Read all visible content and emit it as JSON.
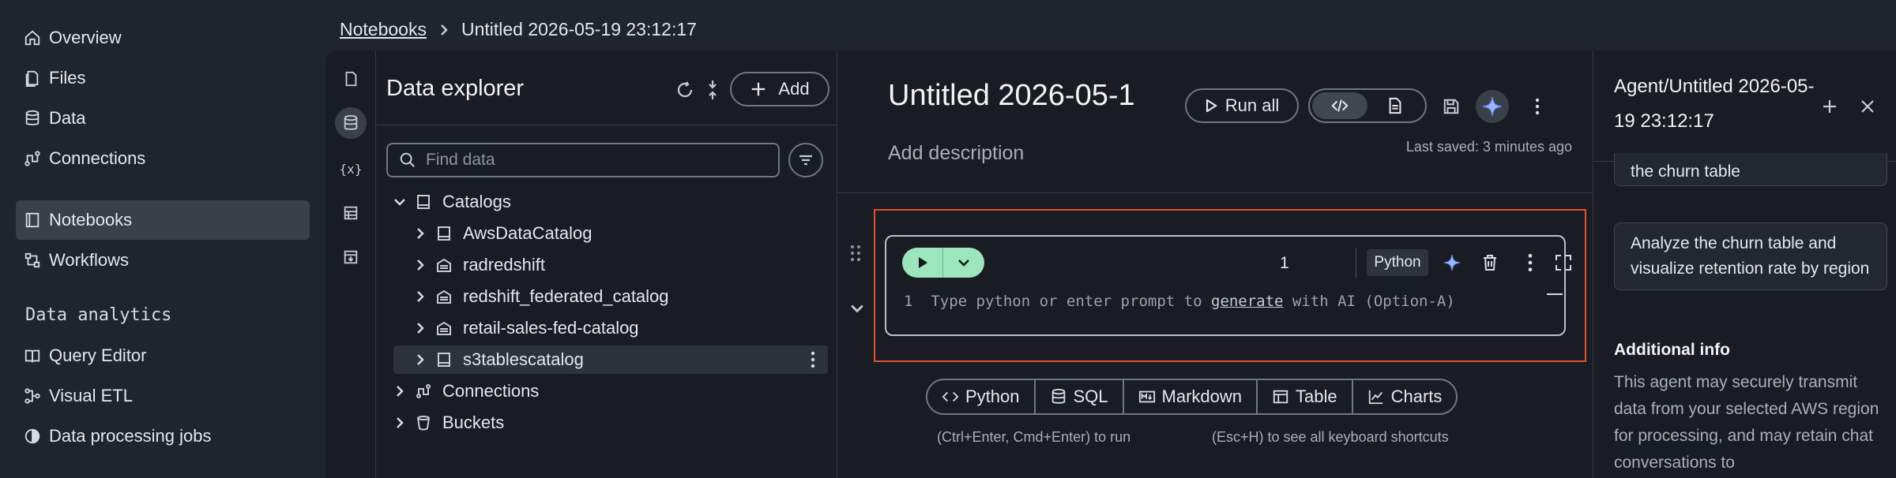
{
  "nav": {
    "items": [
      {
        "label": "Overview",
        "icon": "home-icon"
      },
      {
        "label": "Files",
        "icon": "file-icon"
      },
      {
        "label": "Data",
        "icon": "database-icon"
      },
      {
        "label": "Connections",
        "icon": "connections-icon"
      },
      {
        "label": "Notebooks",
        "icon": "notebook-icon",
        "active": true
      },
      {
        "label": "Workflows",
        "icon": "workflow-icon"
      }
    ],
    "section_label": "Data analytics",
    "analytics_items": [
      {
        "label": "Query Editor",
        "icon": "book-icon"
      },
      {
        "label": "Visual ETL",
        "icon": "etl-icon"
      },
      {
        "label": "Data processing jobs",
        "icon": "jobs-icon"
      }
    ]
  },
  "breadcrumb": {
    "root": "Notebooks",
    "current": "Untitled 2026-05-19 23:12:17"
  },
  "rail": {
    "variables_label": "{x}"
  },
  "explorer": {
    "title": "Data explorer",
    "add_label": "Add",
    "search_placeholder": "Find data",
    "tree": [
      {
        "label": "Catalogs",
        "level": 0,
        "expanded": true,
        "icon": "catalog-icon"
      },
      {
        "label": "AwsDataCatalog",
        "level": 1,
        "icon": "catalog-icon"
      },
      {
        "label": "radredshift",
        "level": 1,
        "icon": "warehouse-icon"
      },
      {
        "label": "redshift_federated_catalog",
        "level": 1,
        "icon": "warehouse-icon"
      },
      {
        "label": "retail-sales-fed-catalog",
        "level": 1,
        "icon": "warehouse-icon"
      },
      {
        "label": "s3tablescatalog",
        "level": 1,
        "icon": "catalog-icon",
        "selected": true
      },
      {
        "label": "Connections",
        "level": 0,
        "icon": "connections-icon"
      },
      {
        "label": "Buckets",
        "level": 0,
        "icon": "bucket-icon"
      }
    ]
  },
  "notebook": {
    "title": "Untitled 2026-05-1",
    "run_all_label": "Run all",
    "description_placeholder": "Add description",
    "last_saved": "Last saved: 3 minutes ago",
    "cell": {
      "execution_count": "1",
      "language": "Python",
      "line_number": "1",
      "code_prefix": "Type python or enter prompt to ",
      "code_link": "generate",
      "code_suffix": " with AI (Option-A)"
    },
    "add_cell_buttons": [
      {
        "label": "Python",
        "icon": "code-icon"
      },
      {
        "label": "SQL",
        "icon": "database-icon"
      },
      {
        "label": "Markdown",
        "icon": "markdown-icon"
      },
      {
        "label": "Table",
        "icon": "table-icon"
      },
      {
        "label": "Charts",
        "icon": "chart-icon"
      }
    ],
    "hint_run": "(Ctrl+Enter, Cmd+Enter) to run",
    "hint_shortcuts": "(Esc+H) to see all keyboard shortcuts"
  },
  "agent": {
    "title": "Agent/Untitled 2026-05-19 23:12:17",
    "messages": [
      "the churn table",
      "Analyze the churn table and visualize retention rate by region"
    ],
    "info_title": "Additional info",
    "info_text": "This agent may securely transmit data from your selected AWS region for processing, and may retain chat conversations to"
  },
  "colors": {
    "accent_run": "#9ce5bd",
    "focus_border": "#e0522f",
    "ai_sparkle": "#9bb8ff"
  }
}
